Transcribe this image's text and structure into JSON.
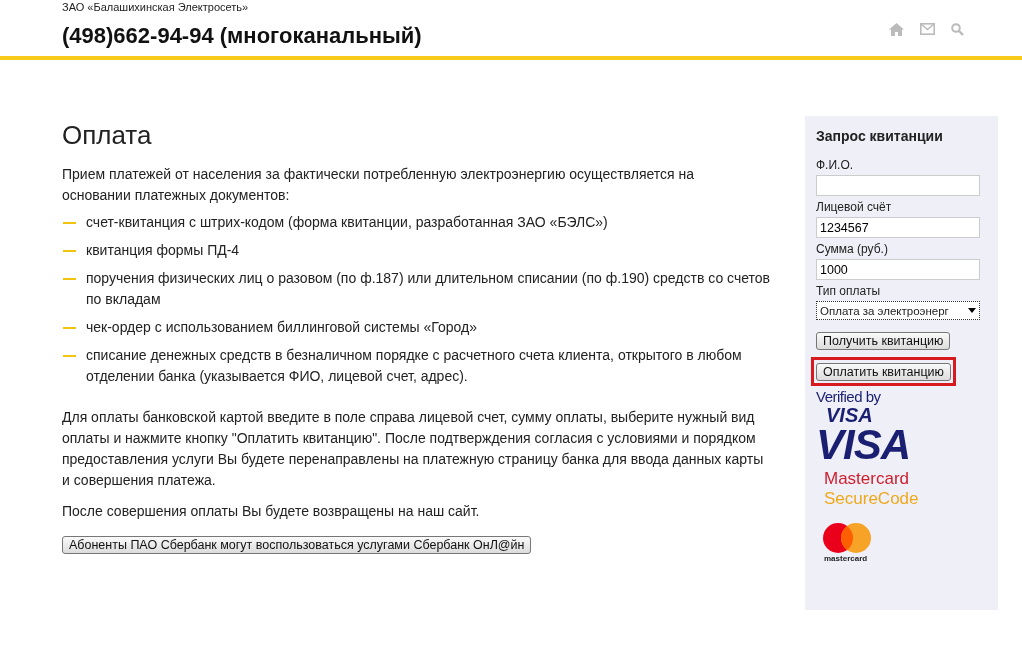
{
  "header": {
    "company": "ЗАО «Балашихинская Электросеть»",
    "phone": "(498)662-94-94 (многоканальный)"
  },
  "main": {
    "title": "Оплата",
    "intro": "Прием платежей от населения за фактически потребленную электроэнергию осуществляется на основании платежных документов:",
    "items": [
      "счет-квитанция с штрих-кодом (форма квитанции, разработанная ЗАО «БЭЛС»)",
      "квитанция формы ПД-4",
      "поручения физических лиц о разовом (по ф.187) или длительном списании (по ф.190) средств со счетов по вкладам",
      "чек-ордер с использованием биллинговой системы «Город»",
      "списание денежных средств в безналичном порядке с расчетного счета клиента, открытого в любом отделении банка (указывается ФИО, лицевой счет, адрес)."
    ],
    "paragraphs": [
      "Для оплаты банковской картой введите в поле справа лицевой счет, сумму оплаты, выберите нужный вид оплаты и нажмите кнопку \"Оплатить квитанцию\". После подтверждения согласия с условиями и порядком предоставления услуги Вы будете перенаправлены на платежную страницу банка для ввода данных карты и совершения платежа.",
      "После совершения оплаты Вы будете возвращены на наш сайт."
    ],
    "sber_button": "Абоненты ПАО Сбербанк могут воспользоваться услугами Сбербанк ОнЛ@йн"
  },
  "sidebar": {
    "title": "Запрос квитанции",
    "fields": [
      {
        "kind": "input",
        "label": "Ф.И.О."
      },
      {
        "kind": "input",
        "label": "Лицевой счёт",
        "value": "1234567"
      },
      {
        "kind": "input",
        "label": "Сумма (руб.)",
        "value": "1000"
      },
      {
        "kind": "select",
        "label": "Тип оплаты",
        "value": "Оплата за электроэнерг"
      }
    ],
    "buttons": [
      {
        "label": "Получить квитанцию",
        "highlighted": false
      },
      {
        "label": "Оплатить квитанцию",
        "highlighted": true
      }
    ],
    "logos": {
      "verified_by": "Verified by",
      "visa_small": "VISA",
      "visa": "VISA",
      "mastercard": "Mastercard",
      "securecode": "SecureCode",
      "mc_label": "mastercard"
    }
  }
}
